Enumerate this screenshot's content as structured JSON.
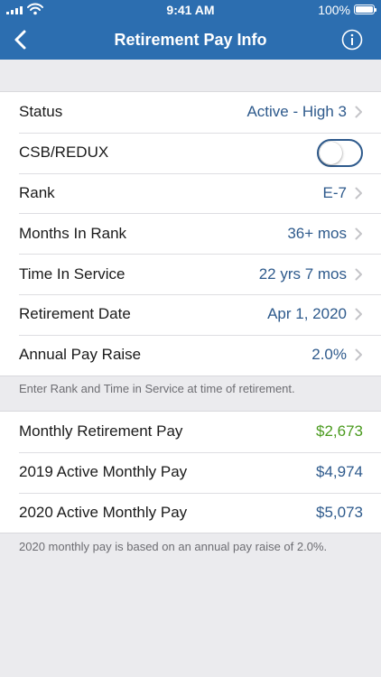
{
  "status_bar": {
    "time": "9:41 AM",
    "battery": "100%"
  },
  "nav": {
    "title": "Retirement Pay Info",
    "back_icon": "chevron-left-icon",
    "info_icon": "info-circle-icon"
  },
  "inputs": {
    "rows": [
      {
        "label": "Status",
        "value": "Active - High 3"
      },
      {
        "label": "CSB/REDUX",
        "toggle_on": false
      },
      {
        "label": "Rank",
        "value": "E-7"
      },
      {
        "label": "Months In Rank",
        "value": "36+ mos"
      },
      {
        "label": "Time In Service",
        "value": "22 yrs 7 mos"
      },
      {
        "label": "Retirement Date",
        "value": "Apr 1, 2020"
      },
      {
        "label": "Annual Pay Raise",
        "value": "2.0%"
      }
    ],
    "footer": "Enter Rank and Time in Service at time of retirement."
  },
  "results": {
    "rows": [
      {
        "label": "Monthly Retirement Pay",
        "value": "$2,673"
      },
      {
        "label": "2019 Active Monthly Pay",
        "value": "$4,974"
      },
      {
        "label": "2020 Active Monthly Pay",
        "value": "$5,073"
      }
    ],
    "footer": "2020 monthly pay is based on an annual pay raise of 2.0%."
  },
  "colors": {
    "bar": "#2c6eb0",
    "value": "#2e5a8c",
    "positive": "#4a9a1e",
    "background": "#ebebee"
  }
}
